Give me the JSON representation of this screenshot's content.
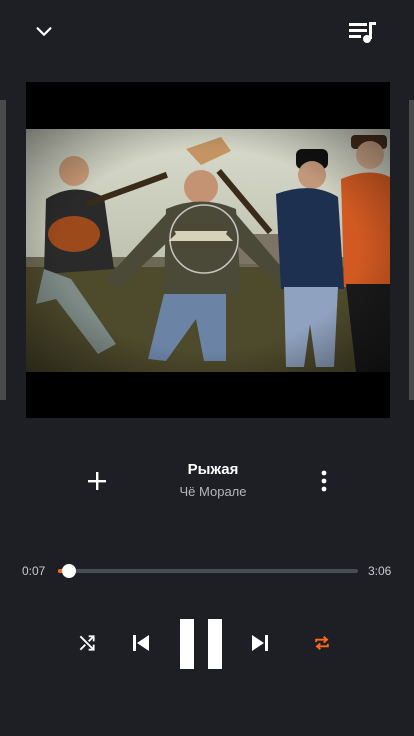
{
  "header": {
    "collapse_icon": "chevron-down-icon",
    "queue_icon": "playlist-queue-icon"
  },
  "track": {
    "title": "Рыжая",
    "artist": "Чё Морале",
    "add_icon": "plus-icon",
    "more_icon": "more-vertical-icon"
  },
  "progress": {
    "elapsed": "0:07",
    "total": "3:06",
    "fraction": 0.038
  },
  "controls": {
    "shuffle_icon": "shuffle-icon",
    "prev_icon": "skip-previous-icon",
    "play_icon": "pause-icon",
    "next_icon": "skip-next-icon",
    "repeat_icon": "repeat-icon",
    "repeat_active": true
  },
  "colors": {
    "background": "#1e1f24",
    "accent": "#ff6a1a",
    "text_secondary": "#b5b7bd"
  }
}
